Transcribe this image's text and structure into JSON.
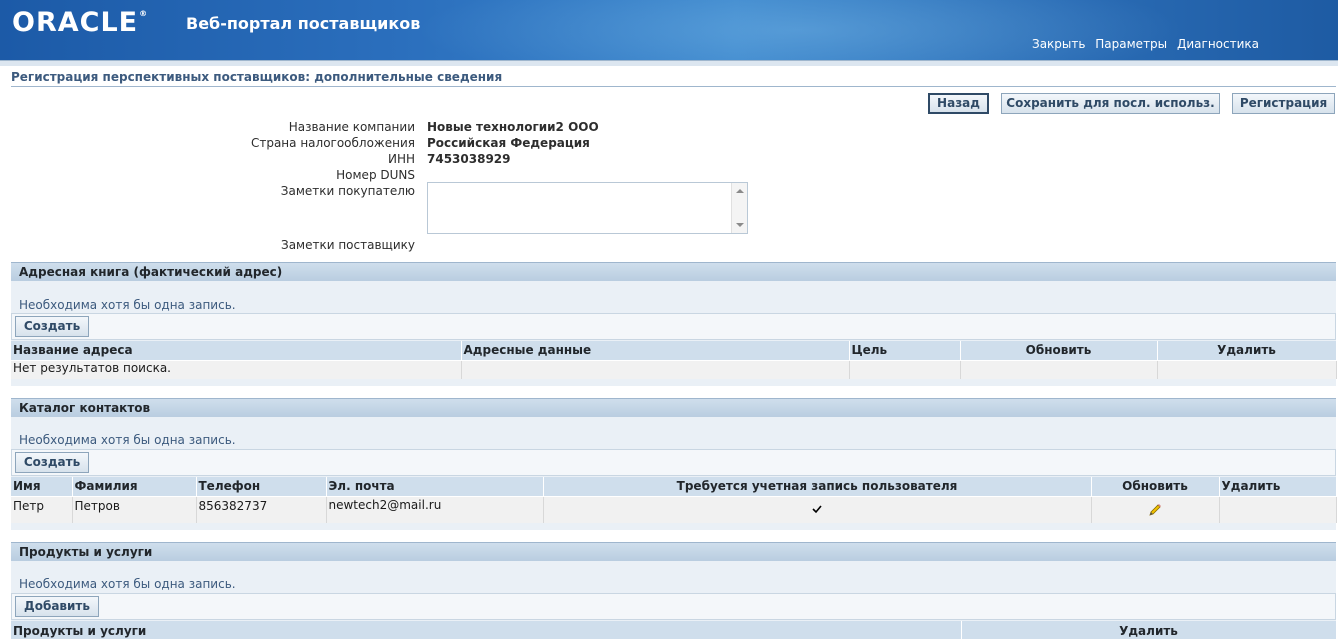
{
  "header": {
    "logo_text": "ORACLE",
    "portal_title": "Веб-портал поставщиков",
    "links": [
      "Закрыть",
      "Параметры",
      "Диагностика"
    ]
  },
  "page": {
    "title": "Регистрация перспективных поставщиков: дополнительные сведения",
    "buttons": {
      "back": "Назад",
      "save": "Сохранить для посл. использ.",
      "register": "Регистрация"
    }
  },
  "form": {
    "company_name_label": "Название компании",
    "company_name_value": "Новые технологии2 ООО",
    "tax_country_label": "Страна налогообложения",
    "tax_country_value": "Российская Федерация",
    "inn_label": "ИНН",
    "inn_value": "7453038929",
    "duns_label": "Номер DUNS",
    "buyer_notes_label": "Заметки покупателю",
    "buyer_notes_value": "",
    "supplier_notes_label": "Заметки поставщику"
  },
  "address_book": {
    "title": "Адресная книга (фактический адрес)",
    "note": "Необходима хотя бы одна запись.",
    "create_button": "Создать",
    "columns": [
      "Название адреса",
      "Адресные данные",
      "Цель",
      "Обновить",
      "Удалить"
    ],
    "empty_text": "Нет результатов поиска."
  },
  "contacts": {
    "title": "Каталог контактов",
    "note": "Необходима хотя бы одна запись.",
    "create_button": "Создать",
    "columns": [
      "Имя",
      "Фамилия",
      "Телефон",
      "Эл. почта",
      "Требуется учетная запись пользователя",
      "Обновить",
      "Удалить"
    ],
    "rows": [
      {
        "first_name": "Петр",
        "last_name": "Петров",
        "phone": "856382737",
        "email": "newtech2@mail.ru",
        "account_required": true
      }
    ]
  },
  "products": {
    "title": "Продукты и услуги",
    "note": "Необходима хотя бы одна запись.",
    "add_button": "Добавить",
    "columns": [
      "Продукты и услуги",
      "Удалить"
    ]
  },
  "colors": {
    "header_blue": "#2b6fbd",
    "section_header": "#cfdeec",
    "label_blue": "#3c5a7e"
  }
}
